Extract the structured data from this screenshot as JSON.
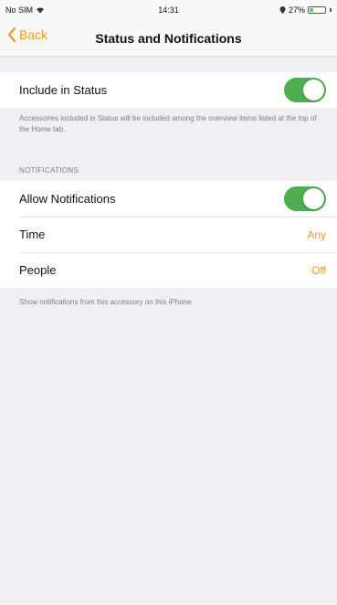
{
  "status_bar": {
    "carrier": "No SIM",
    "time": "14:31",
    "battery": "27%",
    "battery_level": 0.27
  },
  "nav": {
    "back_label": "Back",
    "title": "Status and Notifications"
  },
  "include_status": {
    "label": "Include in Status",
    "on": true,
    "footnote": "Accessories included in Status will be included among the overview items listed at the top of the Home tab."
  },
  "notifications": {
    "header": "NOTIFICATIONS",
    "allow_label": "Allow Notifications",
    "allow_on": true,
    "time_label": "Time",
    "time_value": "Any",
    "people_label": "People",
    "people_value": "Off",
    "footnote": "Show notifications from this accessory on this iPhone."
  },
  "colors": {
    "accent": "#f19a1a",
    "toggle_on": "#4cae4f",
    "background": "#efeff4"
  },
  "icons": [
    "wifi-icon",
    "chevron-left-icon",
    "location-icon",
    "battery-icon"
  ]
}
